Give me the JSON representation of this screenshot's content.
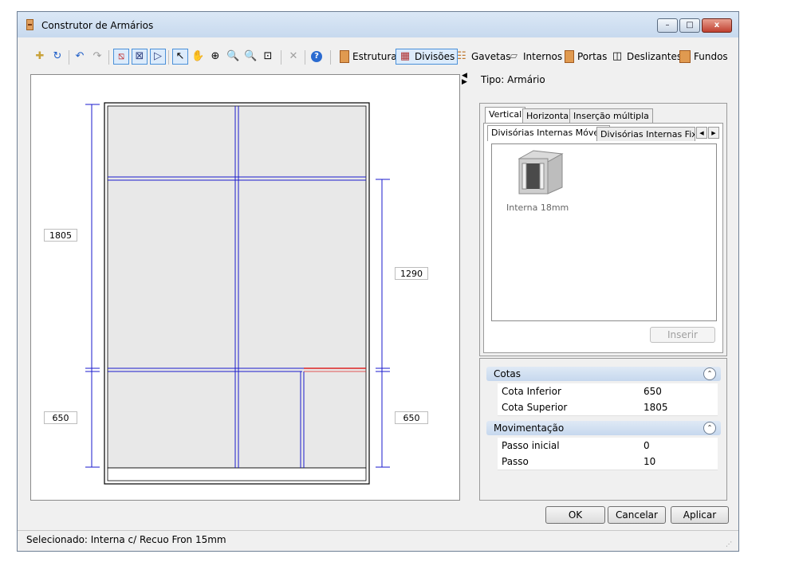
{
  "window": {
    "title": "Construtor de Armários",
    "minimize": "–",
    "maximize": "□",
    "close": "x"
  },
  "toolbar": {
    "estrutura": "Estrutura",
    "divisoes": "Divisões",
    "gavetas": "Gavetas",
    "internos": "Internos",
    "portas": "Portas",
    "deslizantes": "Deslizantes",
    "fundos": "Fundos"
  },
  "drawing": {
    "dim_left_top": "1805",
    "dim_left_bottom": "650",
    "dim_right_top": "1290",
    "dim_right_bottom": "650"
  },
  "side": {
    "type_label": "Tipo: Armário",
    "tabs": [
      "Vertical",
      "Horizontal",
      "Inserção múltipla"
    ],
    "subtabs": [
      "Divisórias Internas Móveis",
      "Divisórias Internas Fixas"
    ],
    "item_label": "Interna 18mm",
    "insert_button": "Inserir"
  },
  "properties": {
    "cotas": {
      "header": "Cotas",
      "rows": [
        {
          "key": "Cota Inferior",
          "value": "650"
        },
        {
          "key": "Cota Superior",
          "value": "1805"
        }
      ]
    },
    "movimentacao": {
      "header": "Movimentação",
      "rows": [
        {
          "key": "Passo inicial",
          "value": "0"
        },
        {
          "key": "Passo",
          "value": "10"
        }
      ]
    }
  },
  "buttons": {
    "ok": "OK",
    "cancel": "Cancelar",
    "apply": "Aplicar"
  },
  "status": "Selecionado: Interna c/ Recuo Fron 15mm"
}
